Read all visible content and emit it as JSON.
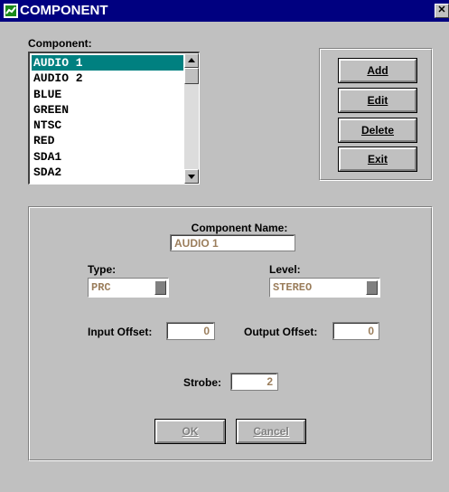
{
  "window": {
    "title": "COMPONENT",
    "close_label": "✕"
  },
  "list": {
    "label": "Component:",
    "items": [
      "AUDIO 1",
      "AUDIO 2",
      "BLUE",
      "GREEN",
      "NTSC",
      "RED",
      "SDA1",
      "SDA2"
    ],
    "selected": "AUDIO 1"
  },
  "actions": {
    "add": "Add",
    "edit": "Edit",
    "delete": "Delete",
    "exit": "Exit"
  },
  "form": {
    "name_label": "Component Name:",
    "name_value": "AUDIO 1",
    "type_label": "Type:",
    "type_value": "PRC",
    "level_label": "Level:",
    "level_value": "STEREO",
    "input_offset_label": "Input Offset:",
    "input_offset_value": "0",
    "output_offset_label": "Output Offset:",
    "output_offset_value": "0",
    "strobe_label": "Strobe:",
    "strobe_value": "2",
    "ok": "OK",
    "cancel": "Cancel"
  },
  "colors": {
    "titlebar": "#000080",
    "selection": "#008080",
    "disabled_value_text": "#9b7e5c",
    "window_bg": "#c0c0c0"
  }
}
